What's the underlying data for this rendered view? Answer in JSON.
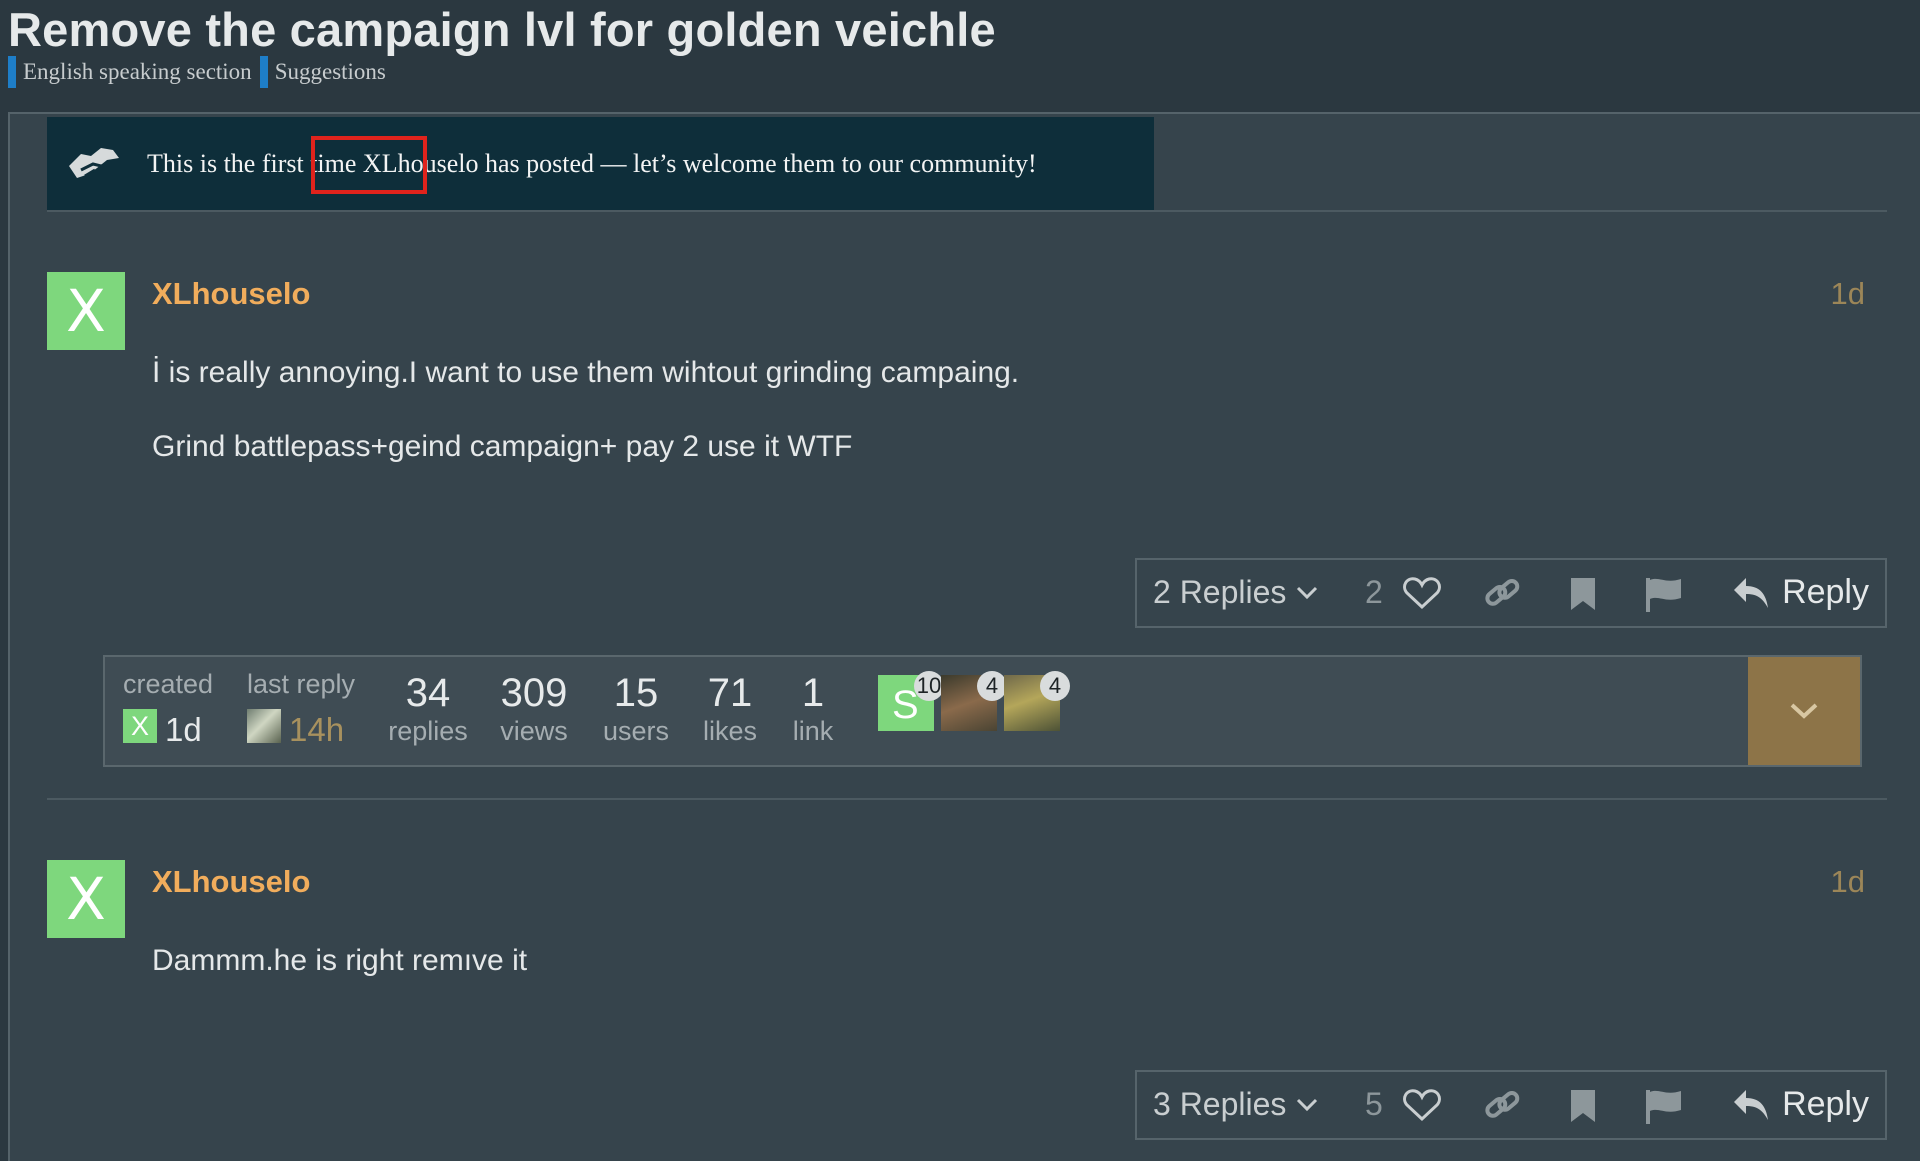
{
  "topic": {
    "title": "Remove the campaign lvl for golden veichle",
    "categories": [
      {
        "name": "English speaking section",
        "color": "#1e7ec8"
      },
      {
        "name": "Suggestions",
        "color": "#1e7ec8"
      }
    ]
  },
  "notice": {
    "text": "This is the first time XLhouselo has posted — let’s welcome them to our community!",
    "highlighted_phrase": "first time",
    "icon": "handshake-icon"
  },
  "posts": [
    {
      "avatar_letter": "X",
      "avatar_color": "#7ed77d",
      "username": "XLhouselo",
      "date": "1d",
      "paragraphs": [
        "İ is really annoying.I want to use them wihtout grinding campaing.",
        "Grind battlepass+geind campaign+ pay 2 use it WTF"
      ],
      "replies_label": "2 Replies",
      "likes": "2",
      "reply_label": "Reply"
    },
    {
      "avatar_letter": "X",
      "avatar_color": "#7ed77d",
      "username": "XLhouselo",
      "date": "1d",
      "paragraphs": [
        "Dammm.he is right remıve it"
      ],
      "replies_label": "3 Replies",
      "likes": "5",
      "reply_label": "Reply"
    }
  ],
  "topic_map": {
    "created_label": "created",
    "created_avatar": "X",
    "created_time": "1d",
    "last_reply_label": "last reply",
    "last_reply_time": "14h",
    "stats": [
      {
        "num": "34",
        "label": "replies"
      },
      {
        "num": "309",
        "label": "views"
      },
      {
        "num": "15",
        "label": "users"
      },
      {
        "num": "71",
        "label": "likes"
      },
      {
        "num": "1",
        "label": "link"
      }
    ],
    "participants": [
      {
        "letter": "S",
        "count": "10"
      },
      {
        "letter": "",
        "count": "4"
      },
      {
        "letter": "",
        "count": "4"
      }
    ]
  },
  "colors": {
    "accent_username": "#f1ad5c",
    "date": "#9c8658",
    "highlight_box": "#e0231c",
    "expand_button": "#8d7448"
  }
}
